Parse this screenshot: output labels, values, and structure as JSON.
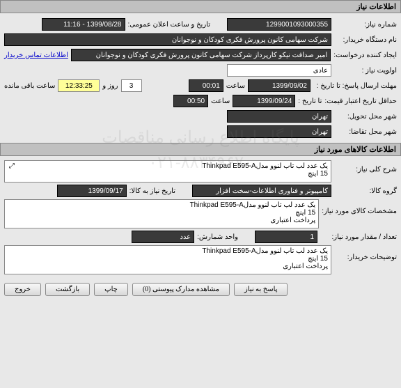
{
  "section1": {
    "title": "اطلاعات نیاز"
  },
  "form1": {
    "request_no_label": "شماره نیاز:",
    "request_no": "1299001093000355",
    "announce_label": "تاریخ و ساعت اعلان عمومی:",
    "announce_value": "1399/08/28 - 11:16",
    "buyer_org_label": "نام دستگاه خریدار:",
    "buyer_org": "شرکت سهامی کانون پرورش فکری کودکان و نوجوانان",
    "creator_label": "ایجاد کننده درخواست:",
    "creator": "امیر صداقت نیکو کارپرداز شرکت سهامی کانون پرورش فکری کودکان و نوجوانان",
    "contact_link": "اطلاعات تماس خریدار",
    "priority_label": "اولویت نیاز :",
    "priority": "عادی",
    "deadline_label": "مهلت ارسال پاسخ:  تا تاریخ :",
    "deadline_date": "1399/09/02",
    "time_label": "ساعت",
    "deadline_time": "00:01",
    "days_count": "3",
    "days_label": "روز و",
    "remaining_time": "12:33:25",
    "remaining_label": "ساعت باقی مانده",
    "validity_label": "حداقل تاریخ اعتبار قیمت:",
    "validity_until_label": "تا تاریخ :",
    "validity_date": "1399/09/24",
    "validity_time": "00:50",
    "delivery_city_label": "شهر محل تحویل:",
    "delivery_city": "تهران",
    "demand_city_label": "شهر محل تقاضا:",
    "demand_city": "تهران"
  },
  "section2": {
    "title": "اطلاعات کالاهای مورد نیاز"
  },
  "form2": {
    "desc_label": "شرح کلی نیاز:",
    "desc_line1": "یک عدد لب تاب لنوو مدلThinkpad E595-A",
    "desc_line2": "15 اینچ",
    "group_label": "گروه کالا:",
    "group": "کامپیوتر و فناوری اطلاعات-سخت افزار",
    "need_date_label": "تاریخ نیاز به کالا:",
    "need_date": "1399/09/17",
    "spec_label": "مشخصات کالای مورد نیاز:",
    "spec_line1": "یک عدد لب تاب لنوو مدلThinkpad E595-A",
    "spec_line2": "15 اینچ",
    "spec_line3": "پرداخت اعتباری",
    "qty_label": "تعداد / مقدار مورد نیاز:",
    "qty": "1",
    "unit_label": "واحد شمارش:",
    "unit": "عدد",
    "buyer_notes_label": "توضیحات خریدار:",
    "notes_line1": "یک عدد لب تاب لنوو مدلThinkpad E595-A",
    "notes_line2": "15 اینچ",
    "notes_line3": "پرداخت اعتباری"
  },
  "buttons": {
    "respond": "پاسخ به نیاز",
    "attachments": "مشاهده مدارک پیوستی (0)",
    "print": "چاپ",
    "back": "بازگشت",
    "exit": "خروج"
  },
  "watermark": {
    "line1": "پایگاه اطلاع رسانی مناقصات",
    "line2": "۰۲۱-۸۸۳۴۹۶۷۰"
  }
}
